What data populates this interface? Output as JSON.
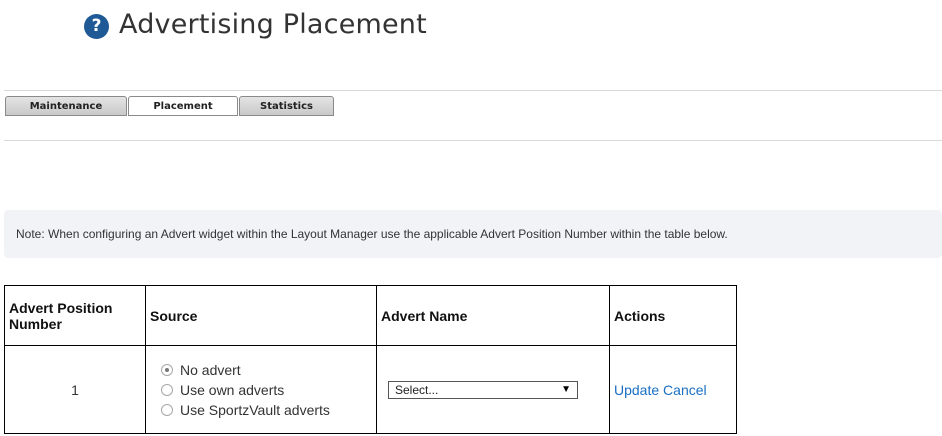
{
  "header": {
    "title": "Advertising Placement",
    "help_icon": "question-circle-icon",
    "help_glyph": "?"
  },
  "tabs": [
    {
      "label": "Maintenance",
      "active": false
    },
    {
      "label": "Placement",
      "active": true
    },
    {
      "label": "Statistics",
      "active": false
    }
  ],
  "note": "Note: When configuring an Advert widget within the Layout Manager use the applicable Advert Position Number within the table below.",
  "table": {
    "headers": {
      "position": "Advert Position Number",
      "source": "Source",
      "advert_name": "Advert Name",
      "actions": "Actions"
    },
    "rows": [
      {
        "position": "1",
        "source_options": [
          {
            "label": "No advert",
            "checked": true
          },
          {
            "label": "Use own adverts",
            "checked": false
          },
          {
            "label": "Use SportzVault adverts",
            "checked": false
          }
        ],
        "advert_select": "Select...",
        "actions": {
          "update": "Update",
          "cancel": "Cancel"
        }
      }
    ]
  },
  "colors": {
    "help_icon": "#1f5a97",
    "link": "#1a6fc4",
    "note_bg": "#f2f3f6"
  }
}
